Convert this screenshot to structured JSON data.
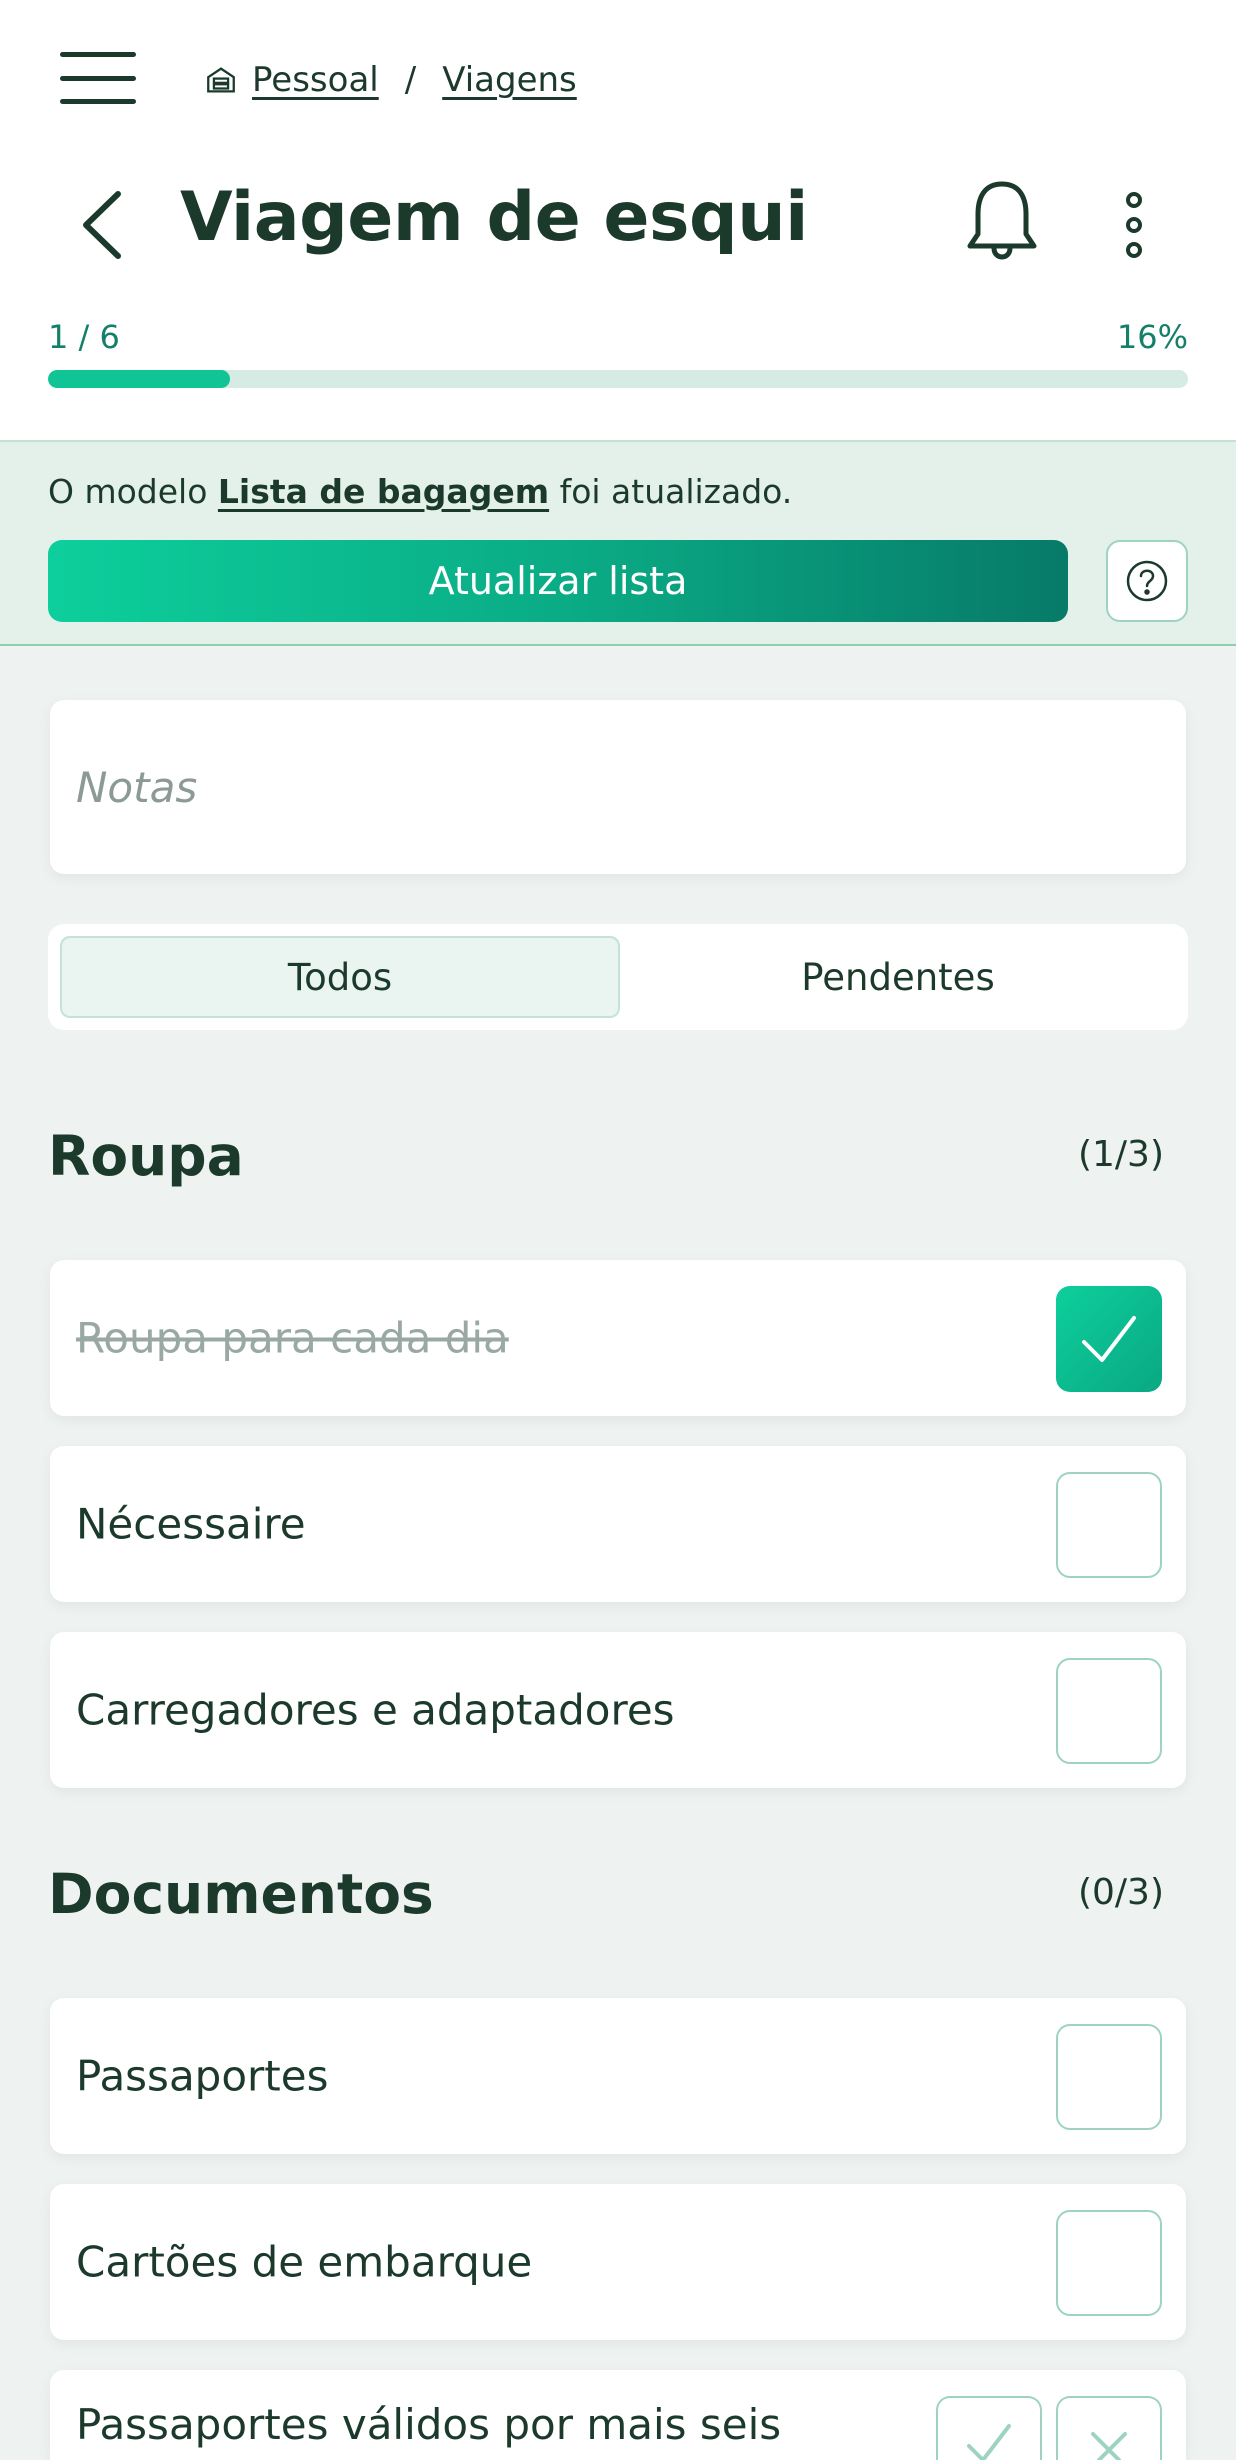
{
  "breadcrumb": {
    "home": "Pessoal",
    "current": "Viagens",
    "separator": "/"
  },
  "page": {
    "title": "Viagem de esqui"
  },
  "progress": {
    "label": "1 / 6",
    "percent_label": "16%",
    "fraction": 0.16
  },
  "banner": {
    "text_before": "O modelo ",
    "link": "Lista de bagagem",
    "text_after": " foi atualizado.",
    "button": "Atualizar lista"
  },
  "notes": {
    "placeholder": "Notas"
  },
  "filter": {
    "tabs": [
      "Todos",
      "Pendentes"
    ],
    "selected": "Todos"
  },
  "sections": [
    {
      "title": "Roupa",
      "count": "(1/3)",
      "items": [
        {
          "label": "Roupa para cada dia",
          "checked": true
        },
        {
          "label": "Nécessaire",
          "checked": false
        },
        {
          "label": "Carregadores e adaptadores",
          "checked": false
        }
      ]
    },
    {
      "title": "Documentos",
      "count": "(0/3)",
      "items": [
        {
          "label": "Passaportes",
          "checked": false
        },
        {
          "label": "Cartões de embarque",
          "checked": false
        },
        {
          "label": "Passaportes válidos por mais seis",
          "checked": false
        }
      ]
    }
  ],
  "colors": {
    "accent": "#10c496",
    "dark_text": "#1c3a2c",
    "banner_bg": "#e3f1ea"
  }
}
